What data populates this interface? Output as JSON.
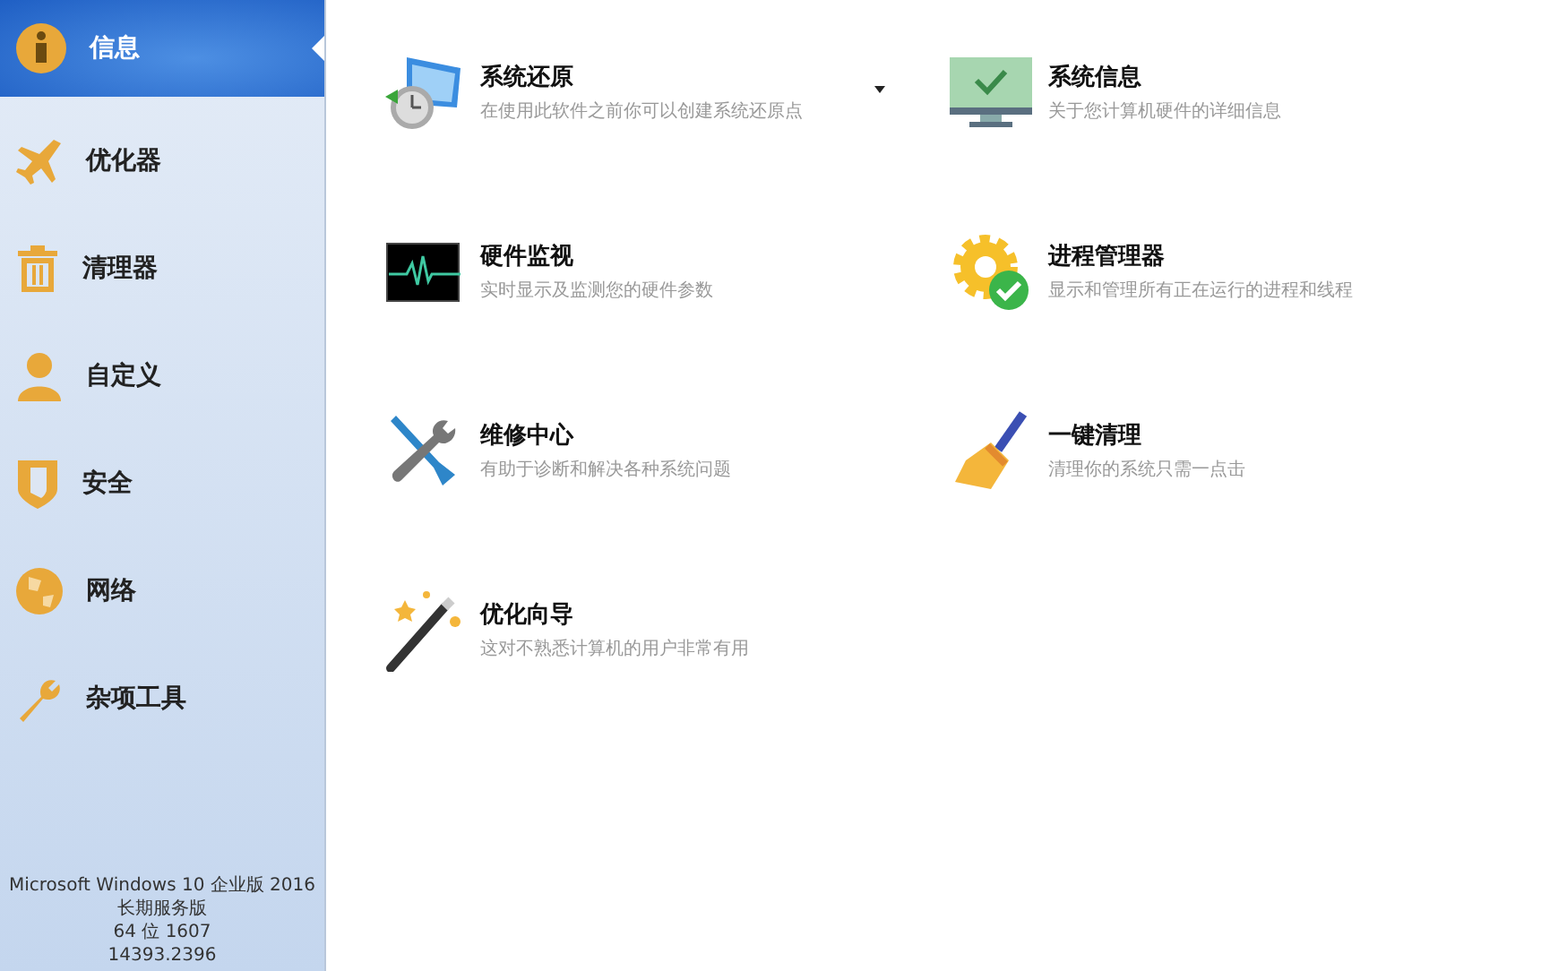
{
  "sidebar": {
    "items": [
      {
        "label": "信息",
        "selected": true
      },
      {
        "label": "优化器",
        "selected": false
      },
      {
        "label": "清理器",
        "selected": false
      },
      {
        "label": "自定义",
        "selected": false
      },
      {
        "label": "安全",
        "selected": false
      },
      {
        "label": "网络",
        "selected": false
      },
      {
        "label": "杂项工具",
        "selected": false
      }
    ],
    "system_info": [
      "Microsoft Windows 10 企业版 2016",
      "长期服务版",
      "64 位 1607",
      "14393.2396"
    ]
  },
  "tools": [
    {
      "title": "系统还原",
      "description": "在使用此软件之前你可以创建系统还原点"
    },
    {
      "title": "系统信息",
      "description": "关于您计算机硬件的详细信息"
    },
    {
      "title": "硬件监视",
      "description": "实时显示及监测您的硬件参数"
    },
    {
      "title": "进程管理器",
      "description": "显示和管理所有正在运行的进程和线程"
    },
    {
      "title": "维修中心",
      "description": "有助于诊断和解决各种系统问题"
    },
    {
      "title": "一键清理",
      "description": "清理你的系统只需一点击"
    },
    {
      "title": "优化向导",
      "description": "这对不熟悉计算机的用户非常有用"
    }
  ]
}
